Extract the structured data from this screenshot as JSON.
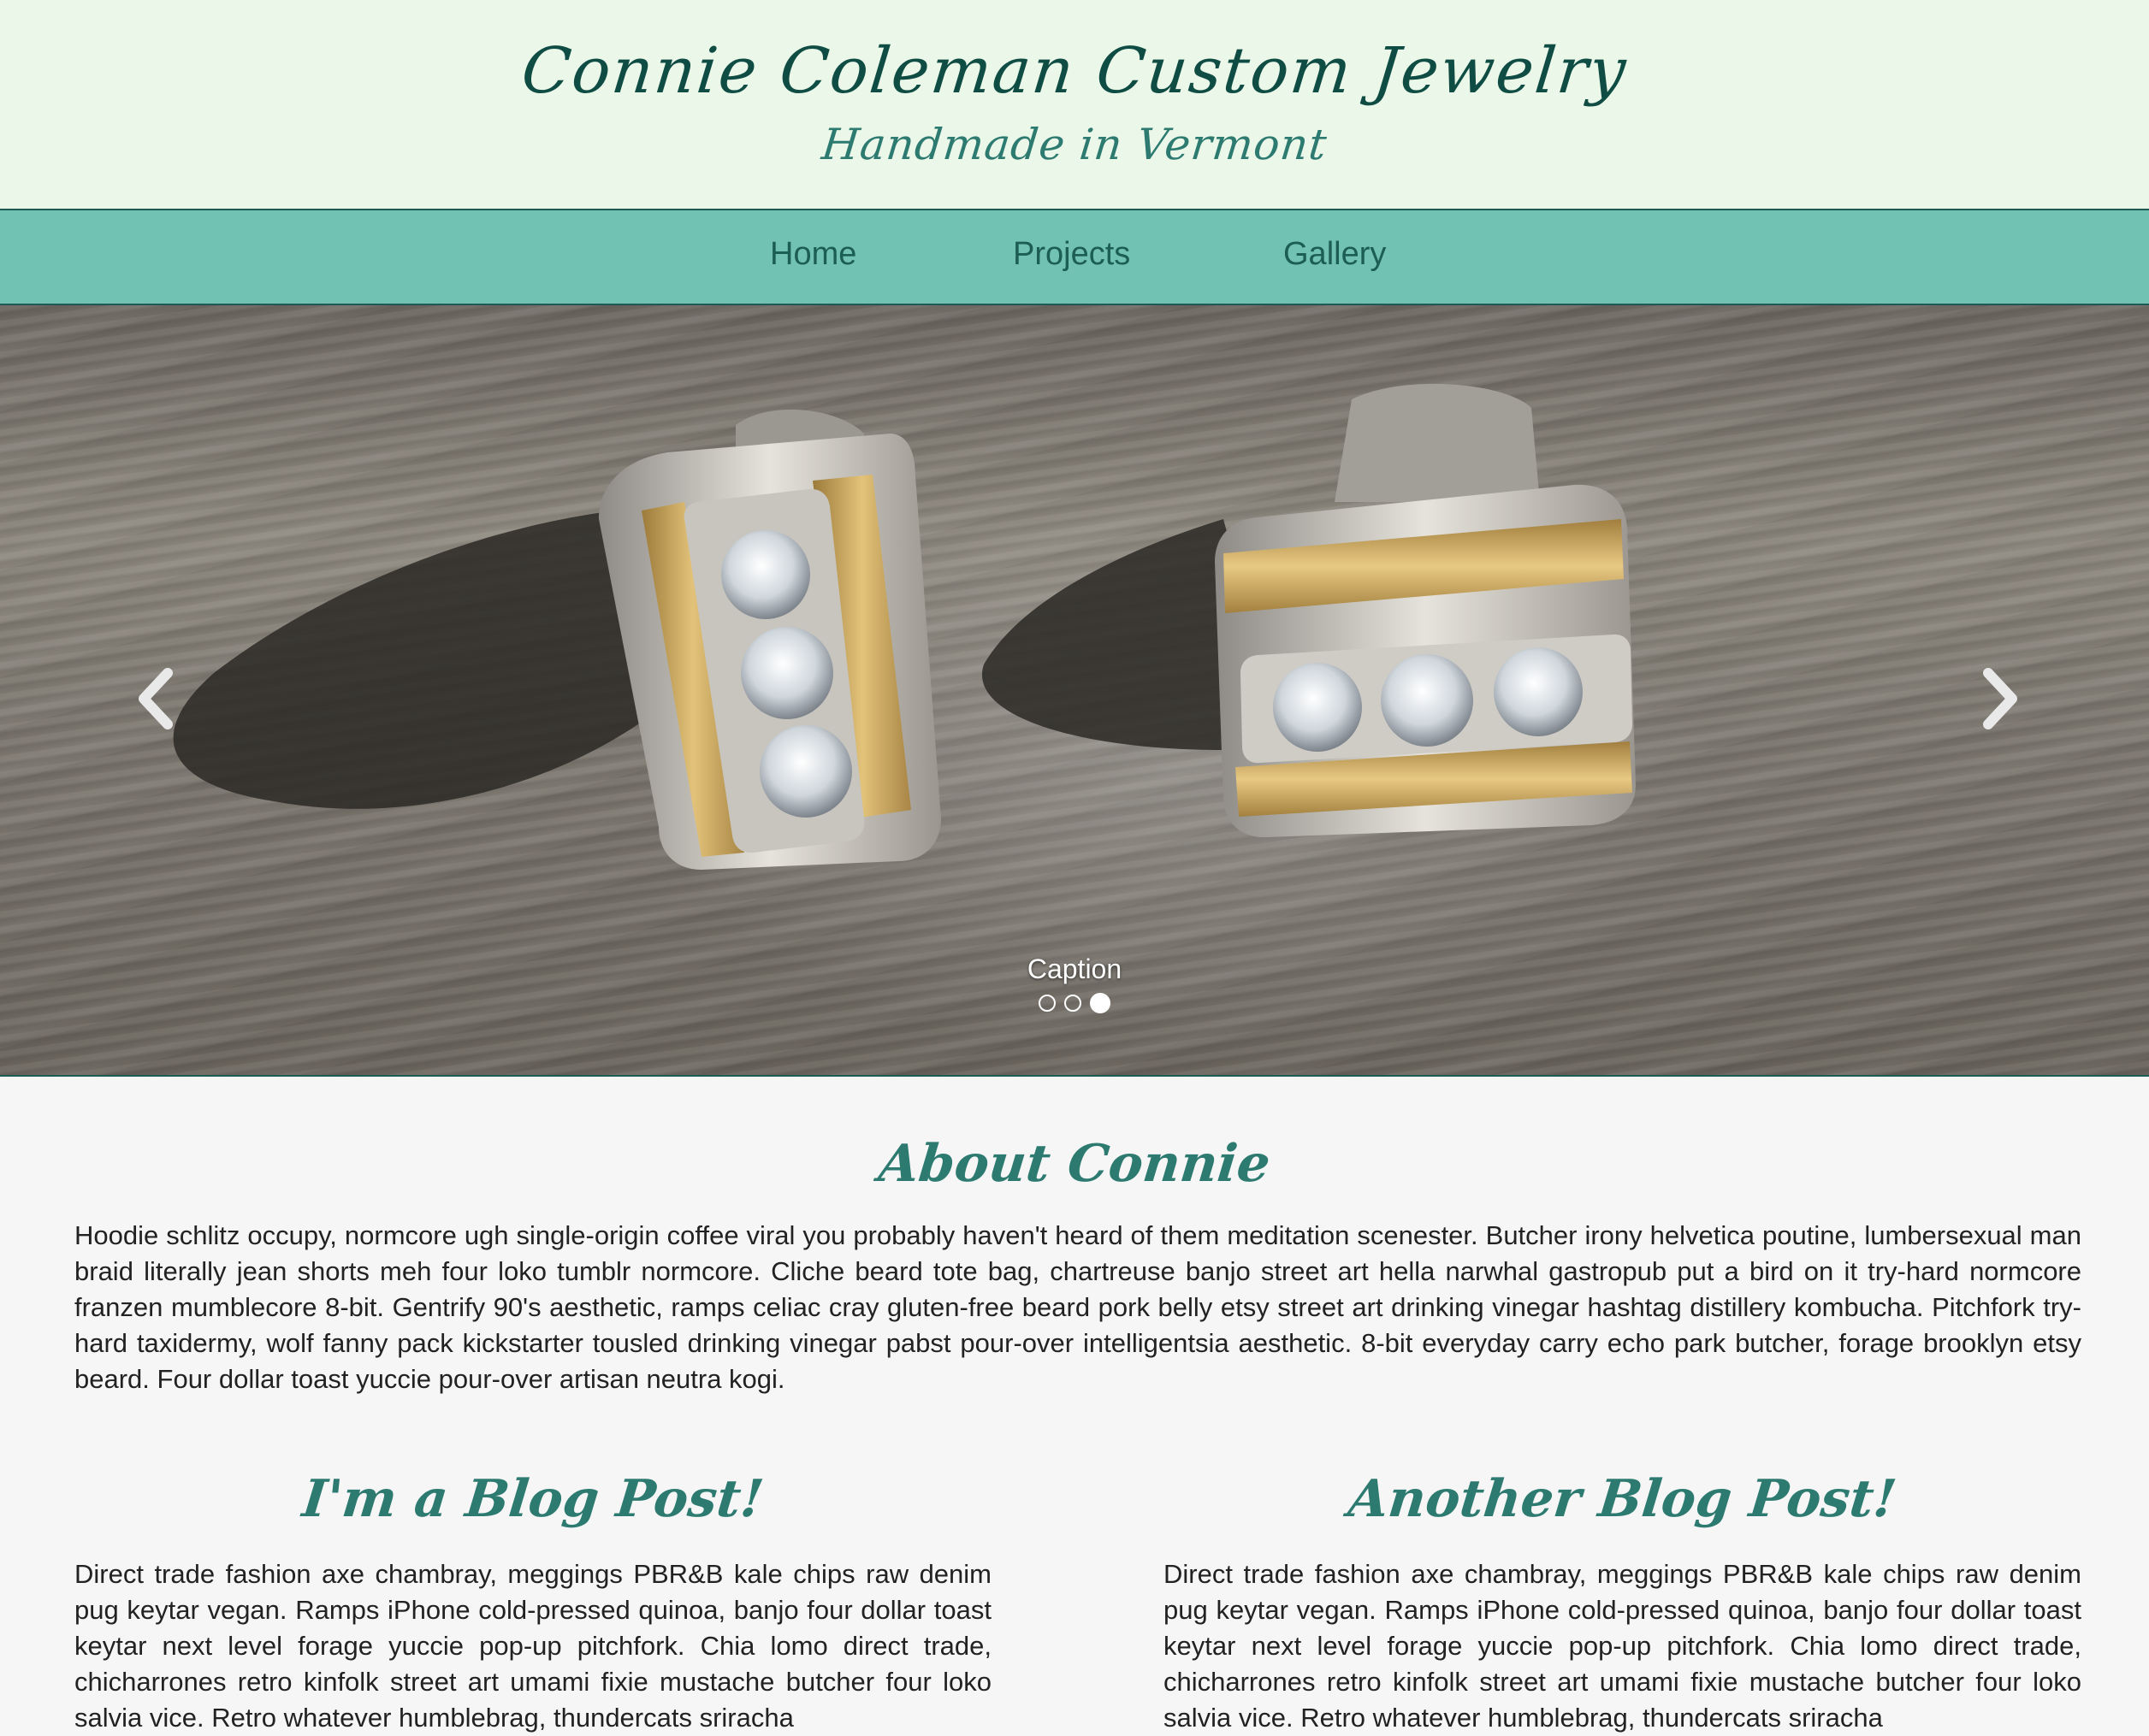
{
  "header": {
    "title": "Connie Coleman Custom Jewelry",
    "tagline": "Handmade in Vermont"
  },
  "nav": {
    "items": [
      {
        "label": "Home"
      },
      {
        "label": "Projects"
      },
      {
        "label": "Gallery"
      }
    ]
  },
  "carousel": {
    "caption": "Caption",
    "slide_count": 3,
    "active_slide": 3,
    "prev_icon": "chevron-left-icon",
    "next_icon": "chevron-right-icon"
  },
  "about": {
    "heading": "About Connie",
    "text": "Hoodie schlitz occupy, normcore ugh single-origin coffee viral you probably haven't heard of them meditation scenester. Butcher irony helvetica poutine, lumbersexual man braid literally jean shorts meh four loko tumblr normcore. Cliche beard tote bag, chartreuse banjo street art hella narwhal gastropub put a bird on it try-hard normcore franzen mumblecore 8-bit. Gentrify 90's aesthetic, ramps celiac cray gluten-free beard pork belly etsy street art drinking vinegar hashtag distillery kombucha. Pitchfork try-hard taxidermy, wolf fanny pack kickstarter tousled drinking vinegar pabst pour-over intelligentsia aesthetic. 8-bit everyday carry echo park butcher, forage brooklyn etsy beard. Four dollar toast yuccie pour-over artisan neutra kogi."
  },
  "blog": {
    "posts": [
      {
        "heading": "I'm a Blog Post!",
        "text": "Direct trade fashion axe chambray, meggings PBR&B kale chips raw denim pug keytar vegan. Ramps iPhone cold-pressed quinoa, banjo four dollar toast keytar next level forage yuccie pop-up pitchfork. Chia lomo direct trade, chicharrones retro kinfolk street art umami fixie mustache butcher four loko salvia vice. Retro whatever humblebrag, thundercats sriracha"
      },
      {
        "heading": "Another Blog Post!",
        "text": "Direct trade fashion axe chambray, meggings PBR&B kale chips raw denim pug keytar vegan. Ramps iPhone cold-pressed quinoa, banjo four dollar toast keytar next level forage yuccie pop-up pitchfork. Chia lomo direct trade, chicharrones retro kinfolk street art umami fixie mustache butcher four loko salvia vice. Retro whatever humblebrag, thundercats sriracha"
      }
    ]
  },
  "colors": {
    "header_bg": "#ebf7e8",
    "nav_bg": "#72c2b3",
    "title": "#0f4c44",
    "accent": "#2d7a70"
  }
}
